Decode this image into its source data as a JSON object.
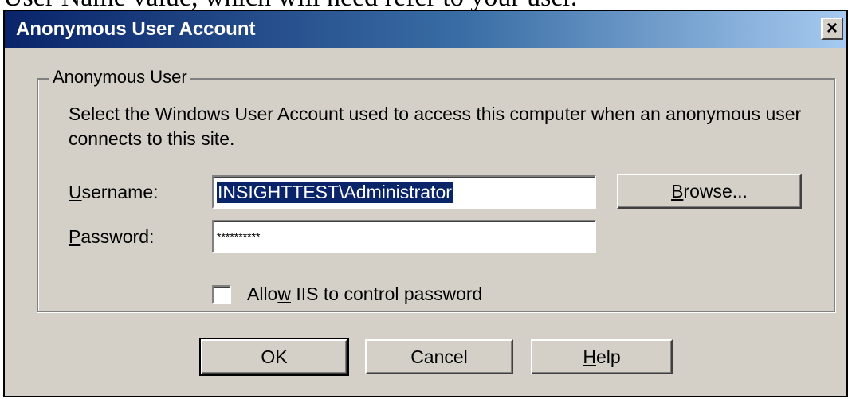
{
  "caption": {
    "text": "User Name value, which will need refer to your user."
  },
  "dialog": {
    "title": "Anonymous User Account",
    "close_glyph": "×",
    "close_icon": "close-icon"
  },
  "group": {
    "legend": "Anonymous User",
    "description": "Select the Windows User Account used to access this computer when an anonymous user connects to this site."
  },
  "username": {
    "label_accel": "U",
    "label_rest": "sername:",
    "value": "INSIGHTTEST\\Administrator"
  },
  "password": {
    "label_accel": "P",
    "label_rest": "assword:",
    "value": "**********"
  },
  "browse_button": {
    "label_accel": "B",
    "label_rest": "rowse..."
  },
  "allow_checkbox": {
    "checked": false,
    "label_pre": "Allo",
    "label_accel": "w",
    "label_rest": " IIS to control password"
  },
  "buttons": {
    "ok": "OK",
    "cancel": "Cancel",
    "help_accel": "H",
    "help_rest": "elp"
  }
}
